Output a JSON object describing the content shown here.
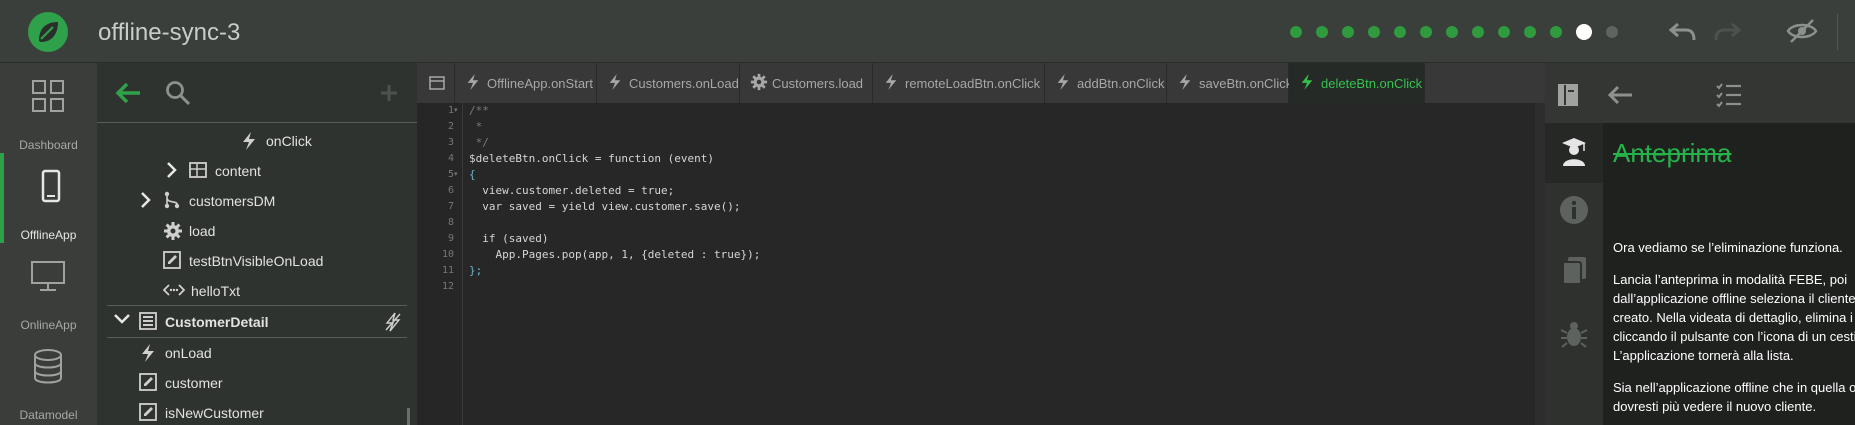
{
  "header": {
    "app_title": "offline-sync-3",
    "progress": {
      "total_steps": 13,
      "current_step": 12
    }
  },
  "nav": {
    "items": [
      {
        "label": "Dashboard",
        "icon": "grid-icon"
      },
      {
        "label": "OfflineApp",
        "icon": "phone-icon",
        "active": true
      },
      {
        "label": "OnlineApp",
        "icon": "monitor-icon"
      },
      {
        "label": "Datamodel",
        "icon": "database-icon"
      }
    ]
  },
  "tree": {
    "rows": [
      {
        "label": "onClick",
        "icon": "bolt-icon"
      },
      {
        "label": "content",
        "icon": "table-icon"
      },
      {
        "label": "customersDM",
        "icon": "hierarchy-icon"
      },
      {
        "label": "load",
        "icon": "gear-icon"
      },
      {
        "label": "testBtnVisibleOnLoad",
        "icon": "edit-icon"
      },
      {
        "label": "helloTxt",
        "icon": "code-icon"
      },
      {
        "label": "CustomerDetail",
        "icon": "form-icon"
      },
      {
        "label": "onLoad",
        "icon": "bolt-icon"
      },
      {
        "label": "customer",
        "icon": "edit-icon"
      },
      {
        "label": "isNewCustomer",
        "icon": "edit-icon"
      }
    ]
  },
  "editor": {
    "tabs": [
      {
        "label": "OfflineApp.onStart",
        "icon": "bolt-icon"
      },
      {
        "label": "Customers.onLoad",
        "icon": "bolt-icon"
      },
      {
        "label": "Customers.load",
        "icon": "gear-icon"
      },
      {
        "label": "remoteLoadBtn.onClick",
        "icon": "bolt-icon"
      },
      {
        "label": "addBtn.onClick",
        "icon": "bolt-icon"
      },
      {
        "label": "saveBtn.onClick",
        "icon": "bolt-icon"
      },
      {
        "label": "deleteBtn.onClick",
        "icon": "bolt-icon",
        "active": true
      }
    ],
    "line_numbers": [
      "1",
      "2",
      "3",
      "4",
      "5",
      "6",
      "7",
      "8",
      "9",
      "10",
      "11",
      "12"
    ],
    "code_lines": [
      "/**",
      " *",
      " */",
      "$deleteBtn.onClick = function (event)",
      "{",
      "  view.customer.deleted = true;",
      "  var saved = yield view.customer.save();",
      "",
      "  if (saved)",
      "    App.Pages.pop(app, 1, {deleted : true});",
      "};",
      ""
    ]
  },
  "preview": {
    "title": "Anteprima",
    "paragraphs": [
      [
        "Ora vediamo se l’eliminazione funziona."
      ],
      [
        "Lancia l’anteprima in modalità FEBE, poi",
        "dall’applicazione offline seleziona il cliente c",
        "creato. Nella videata di dettaglio, elimina i d",
        "cliccando il pulsante con l’icona di un cestin",
        "L’applicazione tornerà alla lista."
      ],
      [
        "Sia nell’applicazione offline che in quella on",
        "dovresti più vedere il nuovo cliente."
      ]
    ]
  },
  "colors": {
    "accent": "#2fa14a",
    "active_tab_text": "#36c04e",
    "header_bg": "#3b3f3b"
  }
}
